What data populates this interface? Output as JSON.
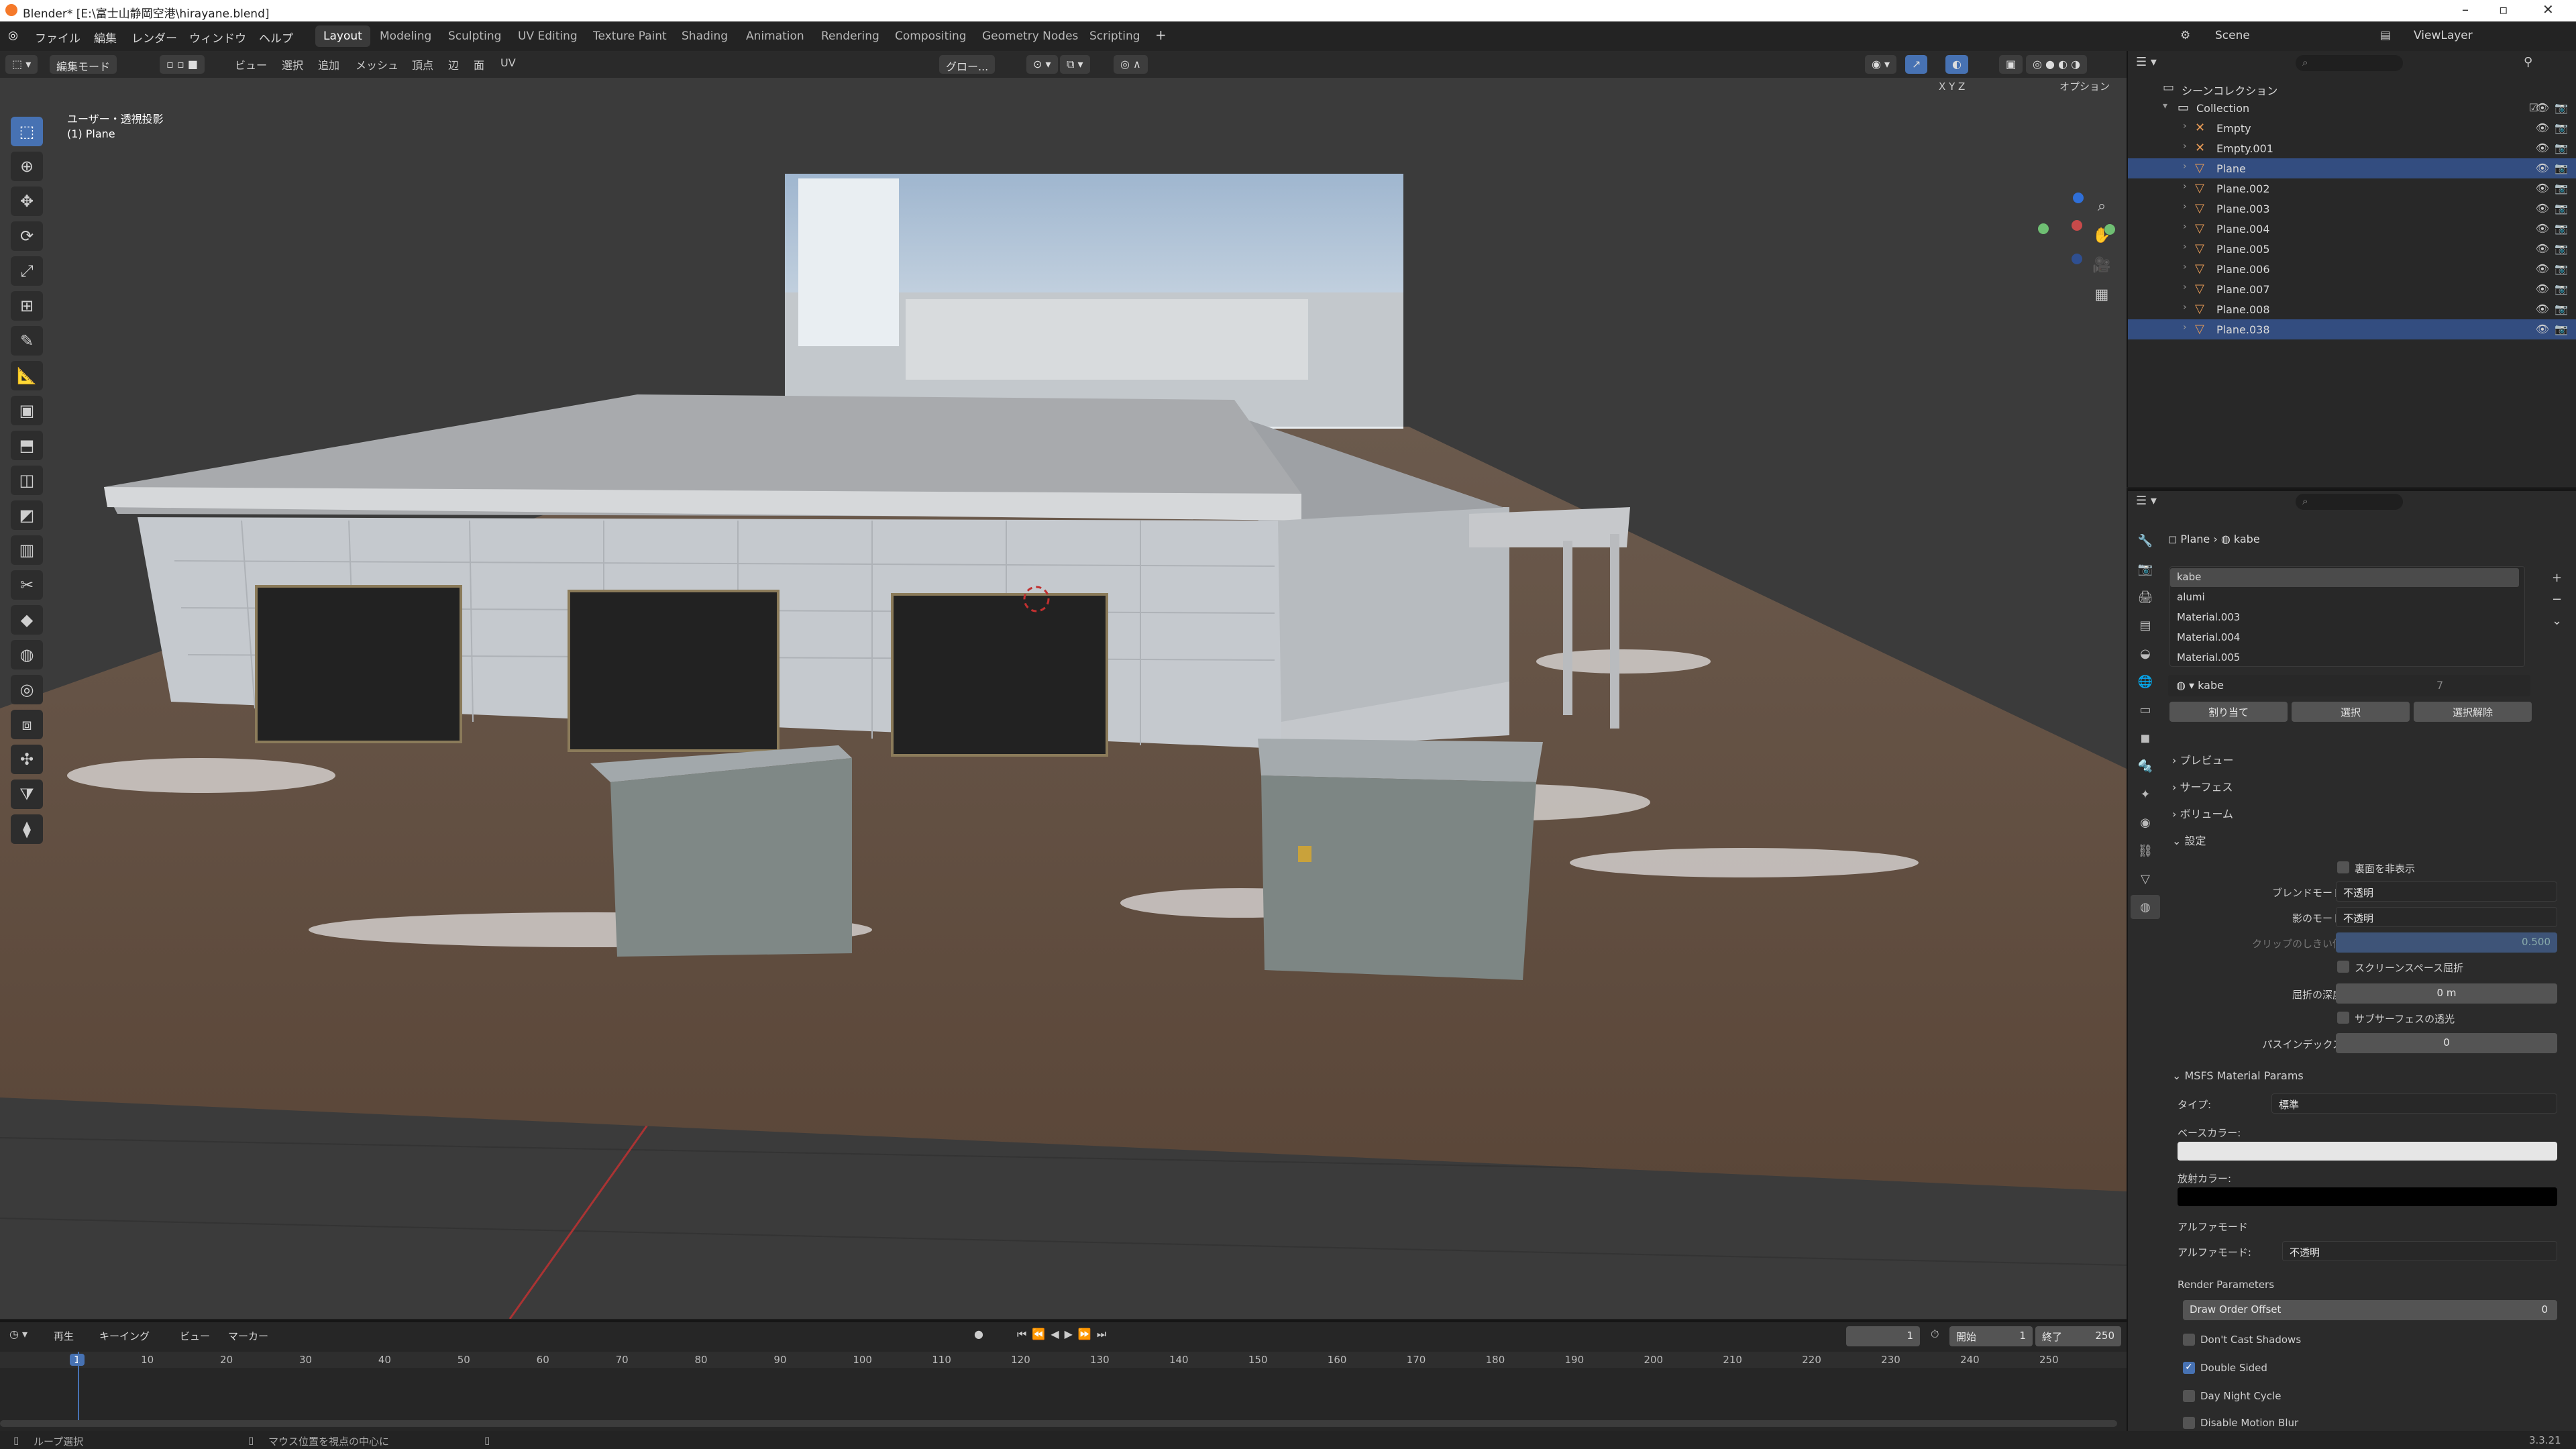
{
  "window": {
    "title": "Blender* [E:\\富士山静岡空港\\hirayane.blend]"
  },
  "menubar": {
    "menus": [
      "ファイル",
      "編集",
      "レンダー",
      "ウィンドウ",
      "ヘルプ"
    ],
    "workspaces": [
      "Layout",
      "Modeling",
      "Sculpting",
      "UV Editing",
      "Texture Paint",
      "Shading",
      "Animation",
      "Rendering",
      "Compositing",
      "Geometry Nodes",
      "Scripting"
    ],
    "active_workspace": "Layout",
    "scene": "Scene",
    "view_layer": "ViewLayer"
  },
  "viewport_header": {
    "mode": "編集モード",
    "menus": [
      "ビュー",
      "選択",
      "追加",
      "メッシュ",
      "頂点",
      "辺",
      "面",
      "UV"
    ],
    "transform_orientation": "グロー...",
    "axes": [
      "X",
      "Y",
      "Z"
    ],
    "options": "オプション"
  },
  "viewport": {
    "view_name": "ユーザー・透視投影",
    "object_name": "(1) Plane"
  },
  "outliner": {
    "root": "シーンコレクション",
    "collection": "Collection",
    "items": [
      {
        "name": "Empty",
        "selected": false
      },
      {
        "name": "Empty.001",
        "selected": false
      },
      {
        "name": "Plane",
        "selected": true
      },
      {
        "name": "Plane.002",
        "selected": false
      },
      {
        "name": "Plane.003",
        "selected": false
      },
      {
        "name": "Plane.004",
        "selected": false
      },
      {
        "name": "Plane.005",
        "selected": false
      },
      {
        "name": "Plane.006",
        "selected": false
      },
      {
        "name": "Plane.007",
        "selected": false
      },
      {
        "name": "Plane.008",
        "selected": false
      },
      {
        "name": "Plane.038",
        "selected": true
      }
    ]
  },
  "properties": {
    "breadcrumb": [
      "Plane",
      "kabe"
    ],
    "materials": [
      "kabe",
      "alumi",
      "Material.003",
      "Material.004",
      "Material.005"
    ],
    "active_material": "kabe",
    "user_count": "7",
    "buttons": [
      "割り当て",
      "選択",
      "選択解除"
    ],
    "sections": {
      "preview": "プレビュー",
      "surface": "サーフェス",
      "volume": "ボリューム",
      "settings": "設定"
    },
    "settings": {
      "backface": "裏面を非表示",
      "blend_mode_label": "ブレンドモード",
      "blend_mode": "不透明",
      "shadow_mode_label": "影のモード",
      "shadow_mode": "不透明",
      "clip_label": "クリップのしきい値",
      "clip_value": "0.500",
      "screen_refraction": "スクリーンスペース屈折",
      "refraction_depth_label": "屈折の深度",
      "refraction_depth": "0 m",
      "subsurface": "サブサーフェスの透光",
      "pass_index_label": "パスインデックス",
      "pass_index": "0"
    },
    "msfs": {
      "title": "MSFS Material Params",
      "type_label": "タイプ:",
      "type": "標準",
      "base_color_label": "ベースカラー:",
      "emission_label": "放射カラー:",
      "alpha_mode_title": "アルファモード",
      "alpha_mode_label": "アルファモード:",
      "alpha_mode": "不透明",
      "render_params": "Render Parameters",
      "draw_order_label": "Draw Order Offset",
      "draw_order": "0",
      "dont_cast_shadows": "Don't Cast Shadows",
      "double_sided": "Double Sided",
      "day_night": "Day Night Cycle",
      "disable_motion_blur": "Disable Motion Blur"
    }
  },
  "timeline": {
    "menus": [
      "再生",
      "キーイング",
      "ビュー",
      "マーカー"
    ],
    "current_frame": "1",
    "start_label": "開始",
    "start": "1",
    "end_label": "終了",
    "end": "250",
    "ticks": [
      "1",
      "10",
      "20",
      "30",
      "40",
      "50",
      "60",
      "70",
      "80",
      "90",
      "100",
      "110",
      "120",
      "130",
      "140",
      "150",
      "160",
      "170",
      "180",
      "190",
      "200",
      "210",
      "220",
      "230",
      "240",
      "250"
    ]
  },
  "statusbar": {
    "left": "ループ選択",
    "middle": "マウス位置を視点の中心に",
    "version": "3.3.21"
  },
  "colors": {
    "accent": "#4772b3",
    "selected_row": "#334d80",
    "orange": "#e69a56",
    "green": "#6fbf73"
  }
}
